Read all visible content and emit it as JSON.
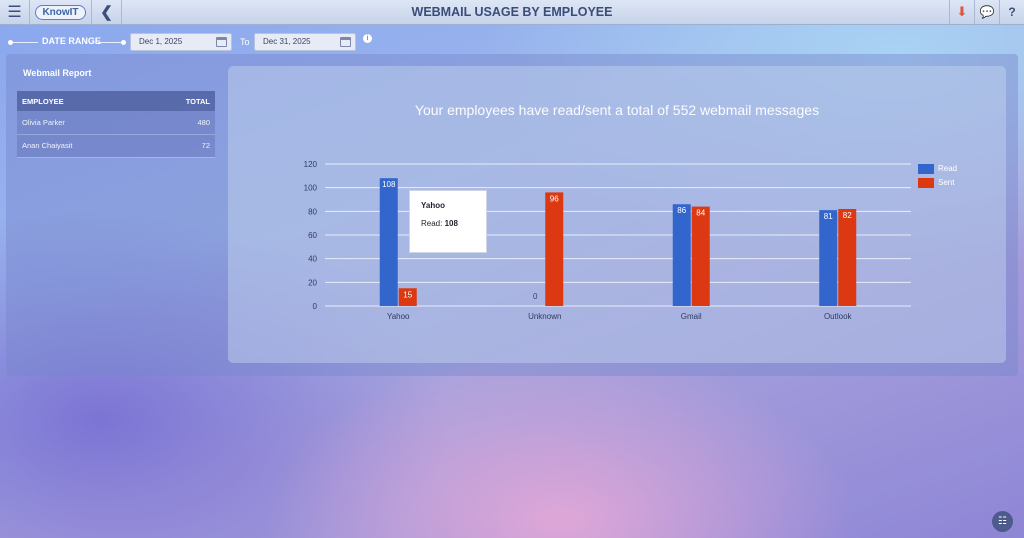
{
  "header": {
    "logo_text": "KnowIT",
    "title": "WEBMAIL USAGE BY EMPLOYEE",
    "icons": [
      "menu-icon",
      "back-arrow-icon",
      "download-icon",
      "chat-icon",
      "help-icon"
    ],
    "menu_glyph": "☰",
    "back_glyph": "❮",
    "download_glyph": "⬇",
    "chat_glyph": "💬",
    "help_glyph": "?"
  },
  "date_range": {
    "label": "DATE RANGE",
    "start": "Dec 1, 2025",
    "separator": "To",
    "end": "Dec 31, 2025",
    "info_glyph": "i"
  },
  "report": {
    "title": "Webmail Report",
    "columns": [
      "EMPLOYEE",
      "TOTAL"
    ],
    "rows": [
      {
        "employee": "Olivia Parker",
        "total": "480"
      },
      {
        "employee": "Anan Chaiyasit",
        "total": "72"
      }
    ]
  },
  "chart": {
    "headline": "Your employees have read/sent a total of 552 webmail messages"
  },
  "chart_data": {
    "type": "bar",
    "categories": [
      "Yahoo",
      "Unknown",
      "Gmail",
      "Outlook"
    ],
    "series": [
      {
        "name": "Read",
        "color": "#3366cc",
        "values": [
          108,
          0,
          86,
          81
        ]
      },
      {
        "name": "Sent",
        "color": "#dc3912",
        "values": [
          15,
          96,
          84,
          82
        ]
      }
    ],
    "ylim": [
      0,
      120
    ],
    "yticks": [
      0,
      20,
      40,
      60,
      80,
      100,
      120
    ],
    "grid": true,
    "legend": "top-right",
    "tooltip": {
      "category": "Yahoo",
      "series": "Read",
      "label": "Read:",
      "value": "108"
    }
  },
  "fab": {
    "glyph": "☷"
  }
}
